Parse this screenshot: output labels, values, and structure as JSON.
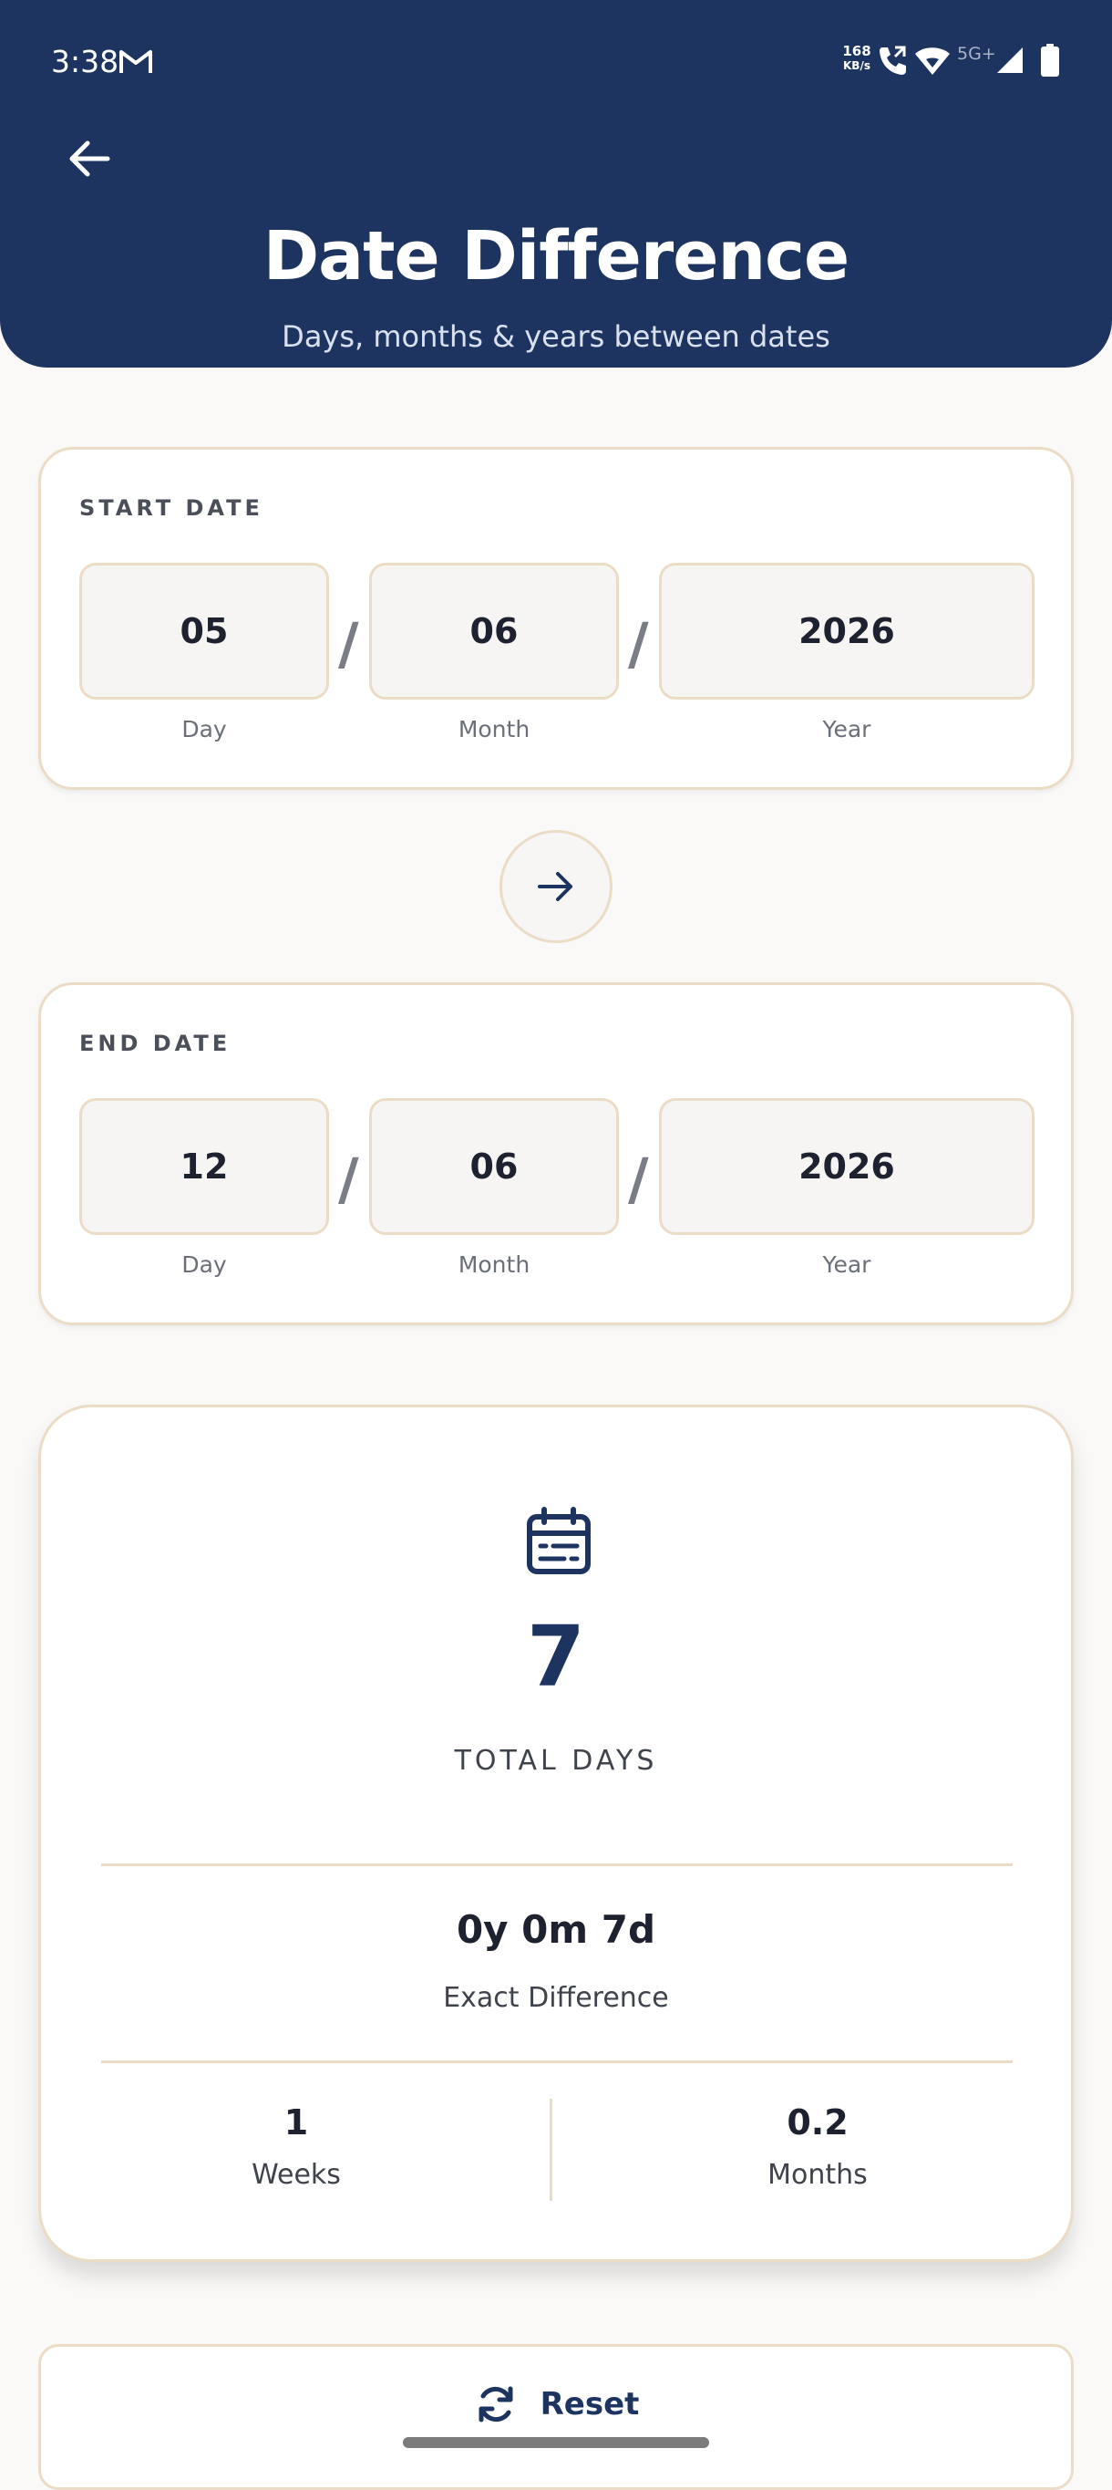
{
  "status_bar": {
    "time": "3:38",
    "net_speed_value": "168",
    "net_speed_unit": "KB/s",
    "network_type": "5G+"
  },
  "header": {
    "title": "Date Difference",
    "subtitle": "Days, months & years between dates"
  },
  "start_date": {
    "label": "START DATE",
    "day": "05",
    "month": "06",
    "year": "2026",
    "day_label": "Day",
    "month_label": "Month",
    "year_label": "Year",
    "separator": "/"
  },
  "end_date": {
    "label": "END DATE",
    "day": "12",
    "month": "06",
    "year": "2026",
    "day_label": "Day",
    "month_label": "Month",
    "year_label": "Year",
    "separator": "/"
  },
  "result": {
    "total_days": "7",
    "total_days_label": "TOTAL DAYS",
    "exact_difference": "0y 0m 7d",
    "exact_difference_label": "Exact Difference",
    "weeks": "1",
    "weeks_label": "Weeks",
    "months": "0.2",
    "months_label": "Months"
  },
  "actions": {
    "reset_label": "Reset"
  },
  "colors": {
    "primary": "#1d3461",
    "accent_border": "#ecdcc6",
    "background": "#faf9f8"
  },
  "icons": [
    "back-arrow-icon",
    "arrow-right-icon",
    "calendar-icon",
    "refresh-icon",
    "gmail-icon",
    "call-icon",
    "wifi-icon",
    "signal-icon",
    "battery-icon"
  ]
}
